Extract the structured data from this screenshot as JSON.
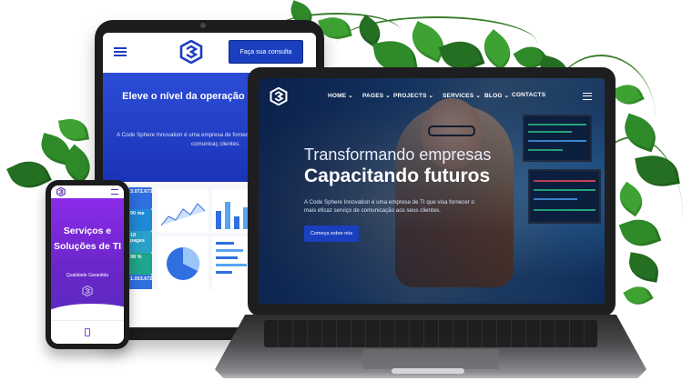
{
  "tablet": {
    "cta_label": "Faça sua consulta",
    "hero_title": "Eleve o nível da operação de dados da sua",
    "hero_subtitle": "A Code Sphere Innovation é uma empresa de fornecer o mais eficaz serviço de comunicaç clientes.",
    "dashboard": {
      "kpis": [
        {
          "value": "3.072.673",
          "color": "#2f6fe0"
        },
        {
          "value": "90 ms",
          "color": "#1f8ad6"
        },
        {
          "value": "18 pages",
          "color": "#2aa1c8"
        },
        {
          "value": "98 %",
          "color": "#1fa68a"
        },
        {
          "value": "1.053.672",
          "color": "#2f6fe0"
        }
      ]
    }
  },
  "laptop": {
    "nav": [
      {
        "label": "HOME ⌄"
      },
      {
        "label": "PAGES ⌄"
      },
      {
        "label": "PROJECTS ⌄"
      },
      {
        "label": "SERVICES ⌄"
      },
      {
        "label": "BLOG ⌄"
      },
      {
        "label": "CONTACTS"
      }
    ],
    "headline_light": "Transformando empresas",
    "headline_bold": "Capacitando futuros",
    "paragraph": "A Code Sphere Innovation é uma empresa de TI que visa fornecer o mais eficaz serviço de comunicação aos seus clientes.",
    "button_label": "Começa sobre nós"
  },
  "phone": {
    "title": "Serviços e Soluções de TI",
    "subtitle": "Qualidade Garantida"
  },
  "colors": {
    "brand_blue": "#1a3fbf",
    "phone_purple": "#7a2be0",
    "leaf_green": "#2f8a2a"
  }
}
